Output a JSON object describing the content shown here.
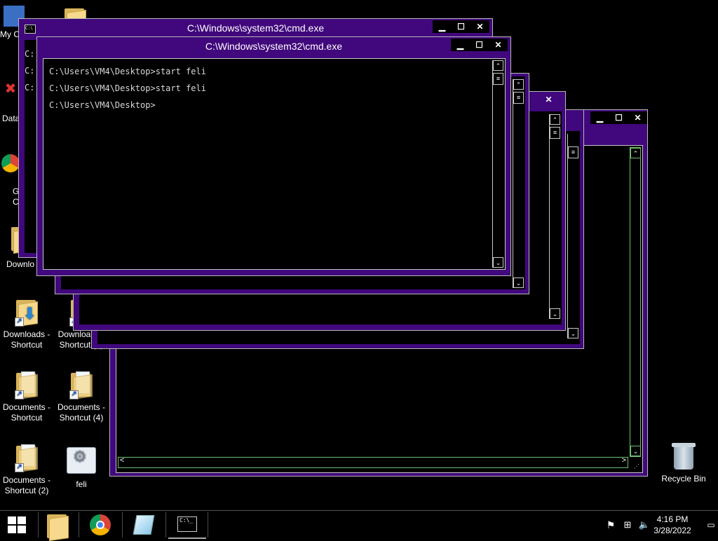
{
  "desktop_icons": [
    {
      "label": "My C"
    },
    {
      "label": "Data"
    },
    {
      "label": "G"
    },
    {
      "label": "C"
    },
    {
      "label": "Downlo"
    },
    {
      "label": "Downloads - Shortcut"
    },
    {
      "label": "Downloads - Shortcut (2)"
    },
    {
      "label": "Documents - Shortcut"
    },
    {
      "label": "Documents - Shortcut (4)"
    },
    {
      "label": "Documents - Shortcut (2)"
    },
    {
      "label": "feli"
    },
    {
      "label": "Recycle Bin"
    }
  ],
  "windows": {
    "title": "C:\\Windows\\system32\\cmd.exe",
    "buttons": {
      "minimize": "▁",
      "maximize": "☐",
      "close": "✕"
    },
    "front_lines": [
      "C:\\Users\\VM4\\Desktop>start feli",
      "C:\\Users\\VM4\\Desktop>start feli",
      "C:\\Users\\VM4\\Desktop>"
    ],
    "peek_prompt": "C:"
  },
  "taskbar": {
    "time": "4:16 PM",
    "date": "3/28/2022"
  },
  "colors": {
    "window_frame": "#40087c",
    "console_bg": "#000000",
    "accent_border": "#c8c8c8"
  }
}
